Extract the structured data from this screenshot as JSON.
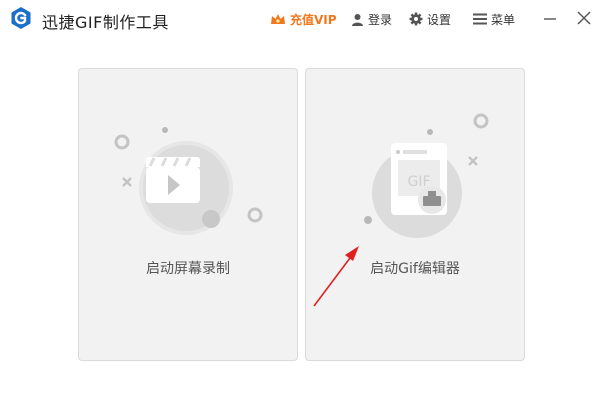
{
  "app": {
    "title": "迅捷GIF制作工具",
    "logo_icon": "logo-g-icon",
    "brand_color": "#1a6fc9"
  },
  "toolbar": {
    "vip_label": "充值VIP",
    "vip_icon": "crown-icon",
    "vip_color": "#f0781e",
    "login_label": "登录",
    "login_icon": "user-icon",
    "settings_label": "设置",
    "settings_icon": "gear-icon",
    "menu_label": "菜单",
    "menu_icon": "hamburger-icon"
  },
  "window_controls": {
    "minimize_icon": "minimize-icon",
    "close_icon": "close-icon"
  },
  "cards": [
    {
      "label": "启动屏幕录制",
      "icon": "video-clapper-icon"
    },
    {
      "label": "启动Gif编辑器",
      "icon": "gif-editor-icon",
      "illustration_text": "GIF"
    }
  ],
  "annotation": {
    "icon": "red-arrow-icon",
    "color": "#e02020"
  }
}
